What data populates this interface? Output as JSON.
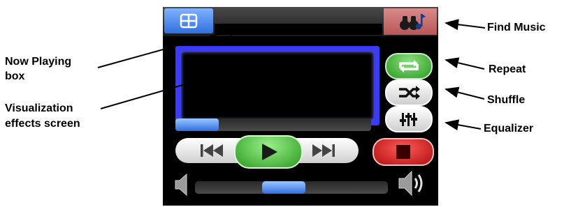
{
  "callouts": {
    "find_music": "Find Music",
    "now_playing": "Now Playing",
    "now_playing_2": "box",
    "repeat": "Repeat",
    "shuffle": "Shuffle",
    "equalizer": "Equalizer",
    "visualization": "Visualization",
    "visualization_2": "effects screen"
  },
  "player": {
    "now_playing_text": "",
    "progress_fraction": 0.22,
    "volume_fraction": 0.45
  },
  "colors": {
    "background": "#000000",
    "accent_blue": "#3a7be8",
    "viz_frame": "#3b3bff",
    "play_green": "#35b82a",
    "repeat_green": "#3cb534",
    "stop_red": "#c81414",
    "find_red": "#c46a6a"
  },
  "icons": {
    "menu": "grid-menu-icon",
    "find": "binoculars-music-icon",
    "repeat": "repeat-icon",
    "shuffle": "shuffle-icon",
    "equalizer": "equalizer-icon",
    "prev": "skip-back-icon",
    "play": "play-icon",
    "next": "skip-forward-icon",
    "stop": "stop-icon",
    "vol_low": "speaker-low-icon",
    "vol_high": "speaker-high-icon"
  }
}
